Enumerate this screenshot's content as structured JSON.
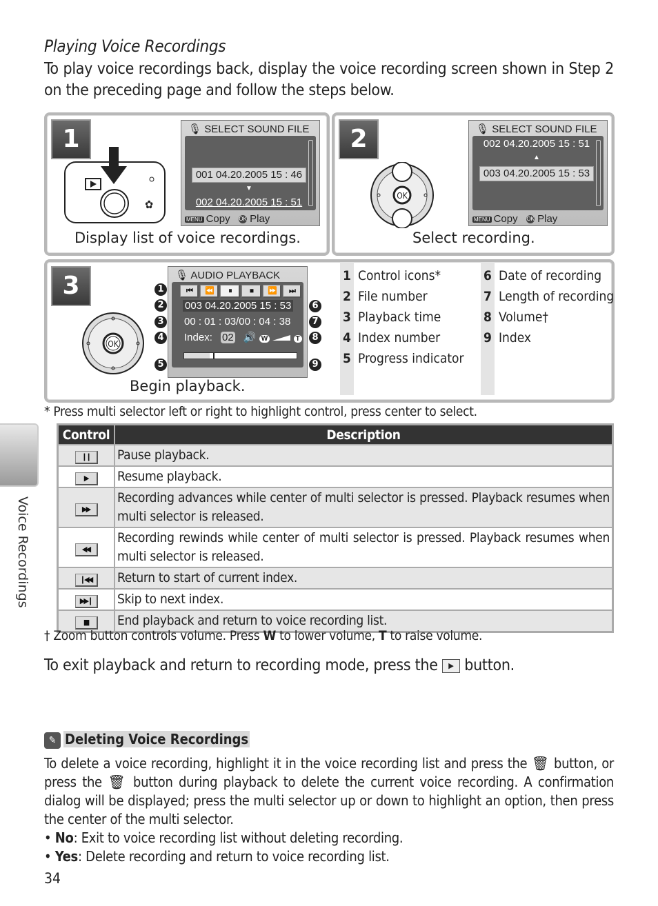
{
  "section_title": "Playing Voice Recordings",
  "intro": "To play voice recordings back, display the voice recording screen shown in Step 2 on the preceding page and follow the steps below.",
  "side_tab": {
    "label": "Voice Recordings"
  },
  "steps": [
    {
      "number": "1",
      "caption": "Display list of voice recordings.",
      "screen": {
        "header": "SELECT SOUND FILE",
        "rows": [
          {
            "text": "001 04.20.2005  15 : 46",
            "selected": true
          },
          {
            "text": "002 04.20.2005  15 : 51",
            "selected": false
          }
        ],
        "arrow": "down-arrow",
        "footer": {
          "menu_tag": "MENU",
          "menu_label": "Copy",
          "ok_tag": "OK",
          "ok_label": "Play"
        }
      }
    },
    {
      "number": "2",
      "caption": "Select recording.",
      "screen": {
        "header": "SELECT SOUND FILE",
        "rows": [
          {
            "text": "002 04.20.2005  15 : 51",
            "selected": false
          },
          {
            "text": "003 04.20.2005  15 : 53",
            "selected": true
          }
        ],
        "arrow": "up-arrow",
        "footer": {
          "menu_tag": "MENU",
          "menu_label": "Copy",
          "ok_tag": "OK",
          "ok_label": "Play"
        }
      }
    },
    {
      "number": "3",
      "caption": "Begin playback.",
      "screen": {
        "header": "AUDIO PLAYBACK",
        "controls": [
          "⏮",
          "⏪",
          "⏸",
          "⏹",
          "⏩",
          "⏭"
        ],
        "file": "003 04.20.2005  15 : 53",
        "time": "00 : 01 : 03/00 : 04 : 38",
        "index_label": "Index:",
        "index_value": "02",
        "volume_w": "W",
        "volume_t": "T",
        "progress_fraction": 0.23,
        "index_marker_fraction": 0.26
      },
      "callouts": [
        "1",
        "2",
        "3",
        "4",
        "5",
        "6",
        "7",
        "8",
        "9"
      ]
    }
  ],
  "legend": {
    "left": [
      {
        "num": "1",
        "label": "Control icons*"
      },
      {
        "num": "2",
        "label": "File number"
      },
      {
        "num": "3",
        "label": "Playback time"
      },
      {
        "num": "4",
        "label": "Index number"
      },
      {
        "num": "5",
        "label": "Progress indicator"
      }
    ],
    "right": [
      {
        "num": "6",
        "label": "Date of recording"
      },
      {
        "num": "7",
        "label": "Length of recording"
      },
      {
        "num": "8",
        "label": "Volume†"
      },
      {
        "num": "9",
        "label": "Index"
      }
    ]
  },
  "footnote_star": "* Press multi selector left or right to highlight control, press center to select.",
  "controls_table": {
    "headers": [
      "Control",
      "Description"
    ],
    "rows": [
      {
        "icon": "pause-icon",
        "glyph": "❙❙",
        "desc": "Pause playback."
      },
      {
        "icon": "play-icon",
        "glyph": "▶",
        "desc": "Resume playback."
      },
      {
        "icon": "fast-forward-icon",
        "glyph": "▶▶",
        "desc": "Recording advances while center of multi selector is pressed.  Playback resumes when multi selector is released."
      },
      {
        "icon": "rewind-icon",
        "glyph": "◀◀",
        "desc": "Recording rewinds while center of multi selector is pressed.  Playback resumes when multi selector is released."
      },
      {
        "icon": "skip-back-icon",
        "glyph": "❙◀◀",
        "desc": "Return to start of current index."
      },
      {
        "icon": "skip-next-icon",
        "glyph": "▶▶❙",
        "desc": "Skip to next index."
      },
      {
        "icon": "stop-icon",
        "glyph": "■",
        "desc": "End playback and return to voice recording list."
      }
    ]
  },
  "footnote_dagger": {
    "prefix": "† Zoom button controls volume.  Press ",
    "w": "W",
    "middle": " to lower volume, ",
    "t": "T",
    "suffix": " to raise volume."
  },
  "exit_note": {
    "before": "To exit playback and return to recording mode, press the",
    "after": "button."
  },
  "deleting": {
    "heading": "Deleting Voice Recordings",
    "p1": "To delete a voice recording, highlight it in the voice recording list and press the",
    "p2": "button, or press the",
    "p3": "button during playback to delete the current voice recording.  A confirmation dialog will be displayed; press the multi selector up or down to highlight an option, then press the center of the multi selector.",
    "bullets": [
      {
        "key": "No",
        "text": ": Exit to voice recording list without deleting recording."
      },
      {
        "key": "Yes",
        "text": ": Delete recording and return to voice recording list."
      }
    ]
  },
  "page_number": "34"
}
